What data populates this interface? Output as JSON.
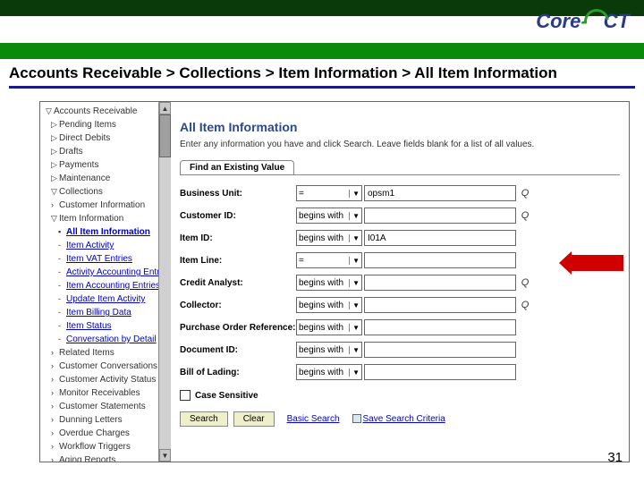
{
  "logo": {
    "text1": "Core",
    "dash": "-",
    "text2": "CT"
  },
  "breadcrumb": "Accounts Receivable > Collections > Item Information > All Item Information",
  "sidebar": {
    "items": [
      {
        "label": "Accounts Receivable",
        "exp": "▽",
        "link": false
      },
      {
        "label": "Pending Items",
        "exp": "▷",
        "sub": 1,
        "link": false
      },
      {
        "label": "Direct Debits",
        "exp": "▷",
        "sub": 1,
        "link": false
      },
      {
        "label": "Drafts",
        "exp": "▷",
        "sub": 1,
        "link": false
      },
      {
        "label": "Payments",
        "exp": "▷",
        "sub": 1,
        "link": false
      },
      {
        "label": "Maintenance",
        "exp": "▷",
        "sub": 1,
        "link": false
      },
      {
        "label": "Collections",
        "exp": "▽",
        "sub": 1,
        "link": false
      },
      {
        "label": "Customer Information",
        "exp": "›",
        "sub": 2,
        "link": false
      },
      {
        "label": "Item Information",
        "exp": "▽",
        "sub": 2,
        "link": false
      },
      {
        "label": "All Item Information",
        "exp": "▪",
        "sub": 3,
        "link": true,
        "selected": true
      },
      {
        "label": "Item Activity",
        "exp": "-",
        "sub": 3,
        "link": true
      },
      {
        "label": "Item VAT Entries",
        "exp": "-",
        "sub": 3,
        "link": true
      },
      {
        "label": "Activity Accounting Entries",
        "exp": "-",
        "sub": 3,
        "link": true
      },
      {
        "label": "Item Accounting Entries",
        "exp": "-",
        "sub": 3,
        "link": true
      },
      {
        "label": "Update Item Activity",
        "exp": "-",
        "sub": 3,
        "link": true
      },
      {
        "label": "Item Billing Data",
        "exp": "-",
        "sub": 3,
        "link": true
      },
      {
        "label": "Item Status",
        "exp": "-",
        "sub": 3,
        "link": true
      },
      {
        "label": "Conversation by Detail",
        "exp": "-",
        "sub": 3,
        "link": true
      },
      {
        "label": "Related Items",
        "exp": "›",
        "sub": 2,
        "link": false
      },
      {
        "label": "Customer Conversations",
        "exp": "›",
        "sub": 2,
        "link": false
      },
      {
        "label": "Customer Activity Status",
        "exp": "›",
        "sub": 2,
        "link": false
      },
      {
        "label": "Monitor Receivables",
        "exp": "›",
        "sub": 2,
        "link": false
      },
      {
        "label": "Customer Statements",
        "exp": "›",
        "sub": 2,
        "link": false
      },
      {
        "label": "Dunning Letters",
        "exp": "›",
        "sub": 2,
        "link": false
      },
      {
        "label": "Overdue Charges",
        "exp": "›",
        "sub": 2,
        "link": false
      },
      {
        "label": "Workflow Triggers",
        "exp": "›",
        "sub": 2,
        "link": false
      },
      {
        "label": "Aging Reports",
        "exp": "›",
        "sub": 2,
        "link": false
      }
    ]
  },
  "main": {
    "title": "All Item Information",
    "desc": "Enter any information you have and click Search. Leave fields blank for a list of all values.",
    "tab": "Find an Existing Value",
    "fields": [
      {
        "label": "Business Unit:",
        "op": "=",
        "value": "opsm1",
        "lookup": true
      },
      {
        "label": "Customer ID:",
        "op": "begins with",
        "value": "",
        "lookup": true
      },
      {
        "label": "Item ID:",
        "op": "begins with",
        "value": "I01A",
        "lookup": false,
        "highlight": true
      },
      {
        "label": "Item Line:",
        "op": "=",
        "value": "",
        "lookup": false
      },
      {
        "label": "Credit Analyst:",
        "op": "begins with",
        "value": "",
        "lookup": true
      },
      {
        "label": "Collector:",
        "op": "begins with",
        "value": "",
        "lookup": true
      },
      {
        "label": "Purchase Order Reference:",
        "op": "begins with",
        "value": "",
        "lookup": false
      },
      {
        "label": "Document ID:",
        "op": "begins with",
        "value": "",
        "lookup": false
      },
      {
        "label": "Bill of Lading:",
        "op": "begins with",
        "value": "",
        "lookup": false
      }
    ],
    "case_sensitive": "Case Sensitive",
    "search": "Search",
    "clear": "Clear",
    "basic": "Basic Search",
    "save": "Save Search Criteria"
  },
  "page_num": "31"
}
